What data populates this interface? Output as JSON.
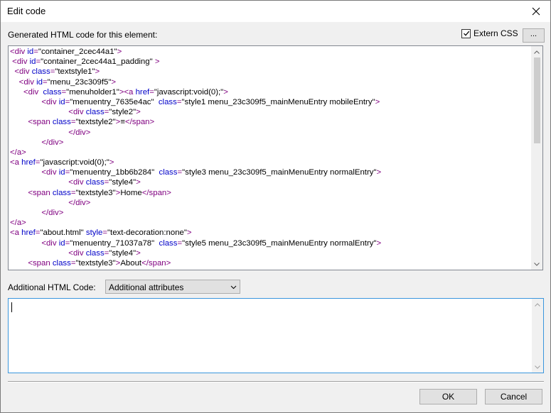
{
  "window": {
    "title": "Edit code"
  },
  "generated": {
    "label": "Generated HTML code for this element:",
    "extern_css_label": "Extern CSS",
    "extern_css_checked": true,
    "browse_label": "...",
    "code_lines": [
      [
        [
          "tag",
          "<div "
        ],
        [
          "attr",
          "id"
        ],
        [
          "tag",
          "="
        ],
        [
          "val",
          "\"container_2cec44a1\""
        ],
        [
          "tag",
          ">"
        ]
      ],
      [
        [
          "txt",
          " "
        ],
        [
          "tag",
          "<div "
        ],
        [
          "attr",
          "id"
        ],
        [
          "tag",
          "="
        ],
        [
          "val",
          "\"container_2cec44a1_padding\""
        ],
        [
          "tag",
          " >"
        ]
      ],
      [
        [
          "txt",
          "  "
        ],
        [
          "tag",
          "<div "
        ],
        [
          "attr",
          "class"
        ],
        [
          "tag",
          "="
        ],
        [
          "val",
          "\"textstyle1\""
        ],
        [
          "tag",
          ">"
        ]
      ],
      [
        [
          "txt",
          "    "
        ],
        [
          "tag",
          "<div "
        ],
        [
          "attr",
          "id"
        ],
        [
          "tag",
          "="
        ],
        [
          "val",
          "\"menu_23c309f5\""
        ],
        [
          "tag",
          ">"
        ]
      ],
      [
        [
          "txt",
          "      "
        ],
        [
          "tag",
          "<div  "
        ],
        [
          "attr",
          "class"
        ],
        [
          "tag",
          "="
        ],
        [
          "val",
          "\"menuholder1\""
        ],
        [
          "tag",
          "><a "
        ],
        [
          "attr",
          "href"
        ],
        [
          "tag",
          "="
        ],
        [
          "val",
          "\"javascript:void(0);\""
        ],
        [
          "tag",
          ">"
        ]
      ],
      [
        [
          "txt",
          "              "
        ],
        [
          "tag",
          "<div "
        ],
        [
          "attr",
          "id"
        ],
        [
          "tag",
          "="
        ],
        [
          "val",
          "\"menuentry_7635e4ac\""
        ],
        [
          "txt",
          "  "
        ],
        [
          "attr",
          "class"
        ],
        [
          "tag",
          "="
        ],
        [
          "val",
          "\"style1 menu_23c309f5_mainMenuEntry mobileEntry\""
        ],
        [
          "tag",
          ">"
        ]
      ],
      [
        [
          "txt",
          "                          "
        ],
        [
          "tag",
          "<div "
        ],
        [
          "attr",
          "class"
        ],
        [
          "tag",
          "="
        ],
        [
          "val",
          "\"style2\""
        ],
        [
          "tag",
          ">"
        ]
      ],
      [
        [
          "txt",
          "        "
        ],
        [
          "tag",
          "<span "
        ],
        [
          "attr",
          "class"
        ],
        [
          "tag",
          "="
        ],
        [
          "val",
          "\"textstyle2\""
        ],
        [
          "tag",
          ">"
        ],
        [
          "txt",
          "≡"
        ],
        [
          "tag",
          "</span>"
        ]
      ],
      [
        [
          "txt",
          "                          "
        ],
        [
          "tag",
          "</div>"
        ]
      ],
      [
        [
          "txt",
          "              "
        ],
        [
          "tag",
          "</div>"
        ]
      ],
      [
        [
          "tag",
          "</a>"
        ]
      ],
      [
        [
          "tag",
          "<a "
        ],
        [
          "attr",
          "href"
        ],
        [
          "tag",
          "="
        ],
        [
          "val",
          "\"javascript:void(0);\""
        ],
        [
          "tag",
          ">"
        ]
      ],
      [
        [
          "txt",
          "              "
        ],
        [
          "tag",
          "<div "
        ],
        [
          "attr",
          "id"
        ],
        [
          "tag",
          "="
        ],
        [
          "val",
          "\"menuentry_1bb6b284\""
        ],
        [
          "txt",
          "  "
        ],
        [
          "attr",
          "class"
        ],
        [
          "tag",
          "="
        ],
        [
          "val",
          "\"style3 menu_23c309f5_mainMenuEntry normalEntry\""
        ],
        [
          "tag",
          ">"
        ]
      ],
      [
        [
          "txt",
          "                          "
        ],
        [
          "tag",
          "<div "
        ],
        [
          "attr",
          "class"
        ],
        [
          "tag",
          "="
        ],
        [
          "val",
          "\"style4\""
        ],
        [
          "tag",
          ">"
        ]
      ],
      [
        [
          "txt",
          "        "
        ],
        [
          "tag",
          "<span "
        ],
        [
          "attr",
          "class"
        ],
        [
          "tag",
          "="
        ],
        [
          "val",
          "\"textstyle3\""
        ],
        [
          "tag",
          ">"
        ],
        [
          "txt",
          "Home"
        ],
        [
          "tag",
          "</span>"
        ]
      ],
      [
        [
          "txt",
          "                          "
        ],
        [
          "tag",
          "</div>"
        ]
      ],
      [
        [
          "txt",
          "              "
        ],
        [
          "tag",
          "</div>"
        ]
      ],
      [
        [
          "tag",
          "</a>"
        ]
      ],
      [
        [
          "tag",
          "<a "
        ],
        [
          "attr",
          "href"
        ],
        [
          "tag",
          "="
        ],
        [
          "val",
          "\"about.html\""
        ],
        [
          "txt",
          " "
        ],
        [
          "attr",
          "style"
        ],
        [
          "tag",
          "="
        ],
        [
          "val",
          "\"text-decoration:none\""
        ],
        [
          "tag",
          ">"
        ]
      ],
      [
        [
          "txt",
          "              "
        ],
        [
          "tag",
          "<div "
        ],
        [
          "attr",
          "id"
        ],
        [
          "tag",
          "="
        ],
        [
          "val",
          "\"menuentry_71037a78\""
        ],
        [
          "txt",
          "  "
        ],
        [
          "attr",
          "class"
        ],
        [
          "tag",
          "="
        ],
        [
          "val",
          "\"style5 menu_23c309f5_mainMenuEntry normalEntry\""
        ],
        [
          "tag",
          ">"
        ]
      ],
      [
        [
          "txt",
          "                          "
        ],
        [
          "tag",
          "<div "
        ],
        [
          "attr",
          "class"
        ],
        [
          "tag",
          "="
        ],
        [
          "val",
          "\"style4\""
        ],
        [
          "tag",
          ">"
        ]
      ],
      [
        [
          "txt",
          "        "
        ],
        [
          "tag",
          "<span "
        ],
        [
          "attr",
          "class"
        ],
        [
          "tag",
          "="
        ],
        [
          "val",
          "\"textstyle3\""
        ],
        [
          "tag",
          ">"
        ],
        [
          "txt",
          "About"
        ],
        [
          "tag",
          "</span>"
        ]
      ]
    ]
  },
  "additional": {
    "label": "Additional HTML Code:",
    "dropdown_value": "Additional attributes",
    "text": ""
  },
  "buttons": {
    "ok": "OK",
    "cancel": "Cancel"
  },
  "colors": {
    "tag": "#800080",
    "attr": "#0000c8",
    "value": "#000000",
    "focus_border": "#3a96dd"
  }
}
